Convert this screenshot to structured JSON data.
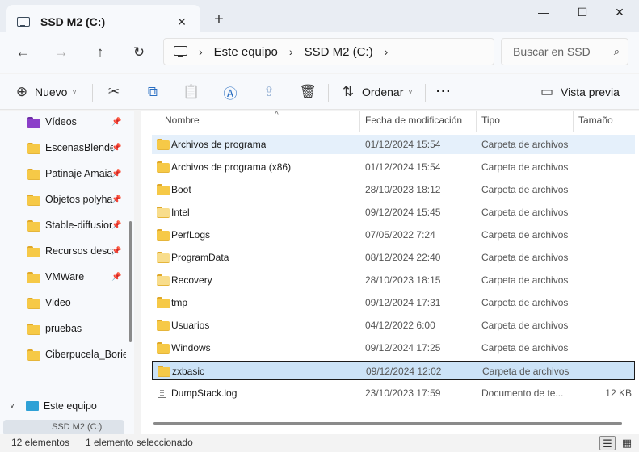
{
  "window": {
    "tab_title": "SSD M2 (C:)",
    "close_tab_glyph": "✕",
    "new_tab_glyph": "+",
    "minimize_glyph": "—",
    "maximize_glyph": "☐",
    "close_glyph": "✕"
  },
  "nav": {
    "back_glyph": "←",
    "forward_glyph": "→",
    "up_glyph": "↑",
    "refresh_glyph": "↻",
    "breadcrumb": [
      "Este equipo",
      "SSD M2 (C:)"
    ],
    "separator": "›",
    "search_placeholder": "Buscar en SSD",
    "search_icon": "⌕"
  },
  "toolbar": {
    "new_label": "Nuevo",
    "new_icon": "⊕",
    "cut_icon": "✂",
    "copy_icon": "⧉",
    "paste_icon": "📋",
    "rename_icon": "Ⓐ",
    "share_icon": "⇪",
    "delete_icon": "🗑",
    "sort_label": "Ordenar",
    "sort_icon": "⇅",
    "more_glyph": "···",
    "preview_label": "Vista previa",
    "preview_icon": "▭",
    "caret": "˅"
  },
  "sidebar": {
    "items": [
      {
        "label": "Vídeos",
        "icon": "videos-folder",
        "pinned": true
      },
      {
        "label": "EscenasBlender",
        "icon": "folder",
        "pinned": true
      },
      {
        "label": "Patinaje Amaia",
        "icon": "folder",
        "pinned": true
      },
      {
        "label": "Objetos polyha",
        "icon": "folder",
        "pinned": true
      },
      {
        "label": "Stable-diffusior",
        "icon": "folder",
        "pinned": true
      },
      {
        "label": "Recursos desca",
        "icon": "folder",
        "pinned": true
      },
      {
        "label": "VMWare",
        "icon": "folder",
        "pinned": true
      },
      {
        "label": "Video",
        "icon": "folder",
        "pinned": false
      },
      {
        "label": "pruebas",
        "icon": "folder",
        "pinned": false
      },
      {
        "label": "Ciberpucela_Boriel",
        "icon": "folder",
        "pinned": false
      }
    ],
    "pin_glyph": "📌",
    "this_pc_label": "Este equipo",
    "this_pc_chevron": "˅",
    "drive_label": "SSD M2 (C:)"
  },
  "list": {
    "columns": {
      "name": "Nombre",
      "date": "Fecha de modificación",
      "type": "Tipo",
      "size": "Tamaño"
    },
    "sort_glyph": "^",
    "rows": [
      {
        "name": "Archivos de programa",
        "date": "01/12/2024 15:54",
        "type": "Carpeta de archivos",
        "size": "",
        "icon": "folder",
        "state": "hover"
      },
      {
        "name": "Archivos de programa (x86)",
        "date": "01/12/2024 15:54",
        "type": "Carpeta de archivos",
        "size": "",
        "icon": "folder",
        "state": ""
      },
      {
        "name": "Boot",
        "date": "28/10/2023 18:12",
        "type": "Carpeta de archivos",
        "size": "",
        "icon": "folder",
        "state": ""
      },
      {
        "name": "Intel",
        "date": "09/12/2024 15:45",
        "type": "Carpeta de archivos",
        "size": "",
        "icon": "folder-light",
        "state": ""
      },
      {
        "name": "PerfLogs",
        "date": "07/05/2022 7:24",
        "type": "Carpeta de archivos",
        "size": "",
        "icon": "folder",
        "state": ""
      },
      {
        "name": "ProgramData",
        "date": "08/12/2024 22:40",
        "type": "Carpeta de archivos",
        "size": "",
        "icon": "folder-light",
        "state": ""
      },
      {
        "name": "Recovery",
        "date": "28/10/2023 18:15",
        "type": "Carpeta de archivos",
        "size": "",
        "icon": "folder-light",
        "state": ""
      },
      {
        "name": "tmp",
        "date": "09/12/2024 17:31",
        "type": "Carpeta de archivos",
        "size": "",
        "icon": "folder",
        "state": ""
      },
      {
        "name": "Usuarios",
        "date": "04/12/2022 6:00",
        "type": "Carpeta de archivos",
        "size": "",
        "icon": "folder",
        "state": ""
      },
      {
        "name": "Windows",
        "date": "09/12/2024 17:25",
        "type": "Carpeta de archivos",
        "size": "",
        "icon": "folder",
        "state": ""
      },
      {
        "name": "zxbasic",
        "date": "09/12/2024 12:02",
        "type": "Carpeta de archivos",
        "size": "",
        "icon": "folder",
        "state": "selected"
      },
      {
        "name": "DumpStack.log",
        "date": "23/10/2023 17:59",
        "type": "Documento de te...",
        "size": "12 KB",
        "icon": "document",
        "state": ""
      }
    ]
  },
  "status": {
    "count": "12 elementos",
    "selection": "1 elemento seleccionado",
    "details_view_icon": "☰",
    "tiles_view_icon": "▦"
  }
}
